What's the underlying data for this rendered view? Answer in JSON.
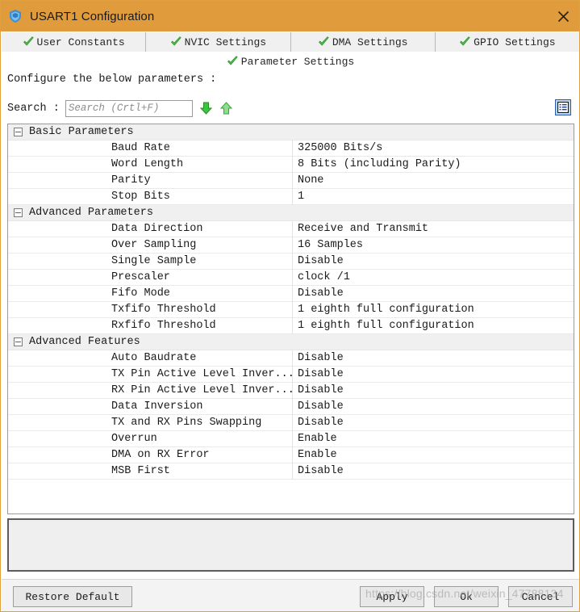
{
  "window": {
    "title": "USART1 Configuration",
    "icon": "shield-icon",
    "close_icon": "close-icon",
    "titlebar_color": "#e09b3d"
  },
  "tabs": {
    "row1": [
      {
        "label": "User Constants",
        "icon": "check-icon",
        "selected": false
      },
      {
        "label": "NVIC Settings",
        "icon": "check-icon",
        "selected": false
      },
      {
        "label": "DMA Settings",
        "icon": "check-icon",
        "selected": false
      },
      {
        "label": "GPIO Settings",
        "icon": "check-icon",
        "selected": false
      }
    ],
    "row2": [
      {
        "label": "Parameter Settings",
        "icon": "check-icon",
        "selected": true
      }
    ]
  },
  "instruction": "Configure the below parameters :",
  "search": {
    "label": "Search :",
    "value": "",
    "placeholder": "Search (Crtl+F)",
    "next_icon": "arrow-down-icon",
    "prev_icon": "arrow-up-icon"
  },
  "toolbar": {
    "list_view_icon": "list-view-icon"
  },
  "groups": [
    {
      "title": "Basic Parameters",
      "expanded": true,
      "rows": [
        {
          "name": "Baud Rate",
          "value": "325000 Bits/s"
        },
        {
          "name": "Word Length",
          "value": "8 Bits (including Parity)"
        },
        {
          "name": "Parity",
          "value": "None"
        },
        {
          "name": "Stop Bits",
          "value": "1"
        }
      ]
    },
    {
      "title": "Advanced Parameters",
      "expanded": true,
      "rows": [
        {
          "name": "Data Direction",
          "value": "Receive and Transmit"
        },
        {
          "name": "Over Sampling",
          "value": "16 Samples"
        },
        {
          "name": "Single Sample",
          "value": "Disable"
        },
        {
          "name": "Prescaler",
          "value": "clock /1"
        },
        {
          "name": "Fifo Mode",
          "value": "Disable"
        },
        {
          "name": "Txfifo Threshold",
          "value": "1 eighth full configuration"
        },
        {
          "name": "Rxfifo Threshold",
          "value": "1 eighth full configuration"
        }
      ]
    },
    {
      "title": "Advanced Features",
      "expanded": true,
      "rows": [
        {
          "name": "Auto Baudrate",
          "value": "Disable"
        },
        {
          "name": "TX Pin Active Level Inver...",
          "value": "Disable"
        },
        {
          "name": "RX Pin Active Level Inver...",
          "value": "Disable"
        },
        {
          "name": "Data Inversion",
          "value": "Disable"
        },
        {
          "name": "TX and RX Pins Swapping",
          "value": "Disable"
        },
        {
          "name": "Overrun",
          "value": "Enable"
        },
        {
          "name": "DMA on RX Error",
          "value": "Enable"
        },
        {
          "name": "MSB First",
          "value": "Disable"
        }
      ]
    }
  ],
  "description_panel": {
    "text": ""
  },
  "buttons": {
    "restore": "Restore Default",
    "apply": "Apply",
    "ok": "Ok",
    "cancel": "Cancel"
  },
  "watermark": "https://blog.csdn.net/weixin_47788134"
}
